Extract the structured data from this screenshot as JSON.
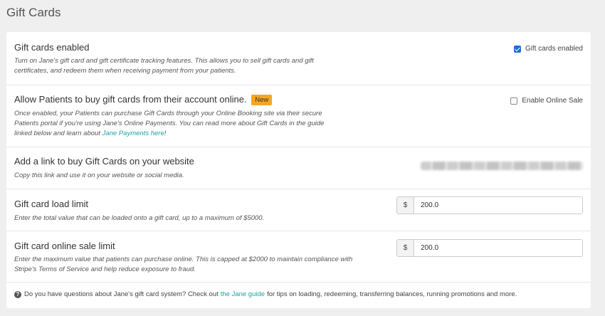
{
  "page": {
    "title": "Gift Cards"
  },
  "sections": {
    "enabled": {
      "title": "Gift cards enabled",
      "desc_line1": "Turn on Jane's gift card and gift certificate tracking features. This allows you to sell gift cards and gift",
      "desc_line2": "certificates, and redeem them when receiving payment from your patients.",
      "checkbox_label": "Gift cards enabled",
      "checked": true
    },
    "online": {
      "title": "Allow Patients to buy gift cards from their account online.",
      "badge": "New",
      "desc_line1": "Once enabled, your Patients can purchase Gift Cards through your Online Booking site via their secure",
      "desc_line2": "Patients portal if you're using Jane's Online Payments. You can read more about Gift Cards in the guide",
      "desc_line3_prefix": "linked below and learn about ",
      "desc_link": "Jane Payments here",
      "desc_line3_suffix": "!",
      "checkbox_label": "Enable Online Sale",
      "checked": false
    },
    "link": {
      "title": "Add a link to buy Gift Cards on your website",
      "desc": "Copy this link and use it on your website or social media."
    },
    "load_limit": {
      "title": "Gift card load limit",
      "desc": "Enter the total value that can be loaded onto a gift card, up to a maximum of $5000.",
      "currency": "$",
      "value": "200.0"
    },
    "online_limit": {
      "title": "Gift card online sale limit",
      "desc_line1": "Enter the maximum value that patients can purchase online. This is capped at $2000 to maintain compliance with",
      "desc_line2": "Stripe's Terms of Service and help reduce exposure to fraud.",
      "currency": "$",
      "value": "200.0"
    }
  },
  "footer": {
    "icon": "question-circle-icon",
    "text_before": "Do you have questions about Jane's gift card system? Check out",
    "link": "the Jane guide",
    "text_after": "for tips on loading, redeeming, transferring balances, running promotions and more."
  }
}
